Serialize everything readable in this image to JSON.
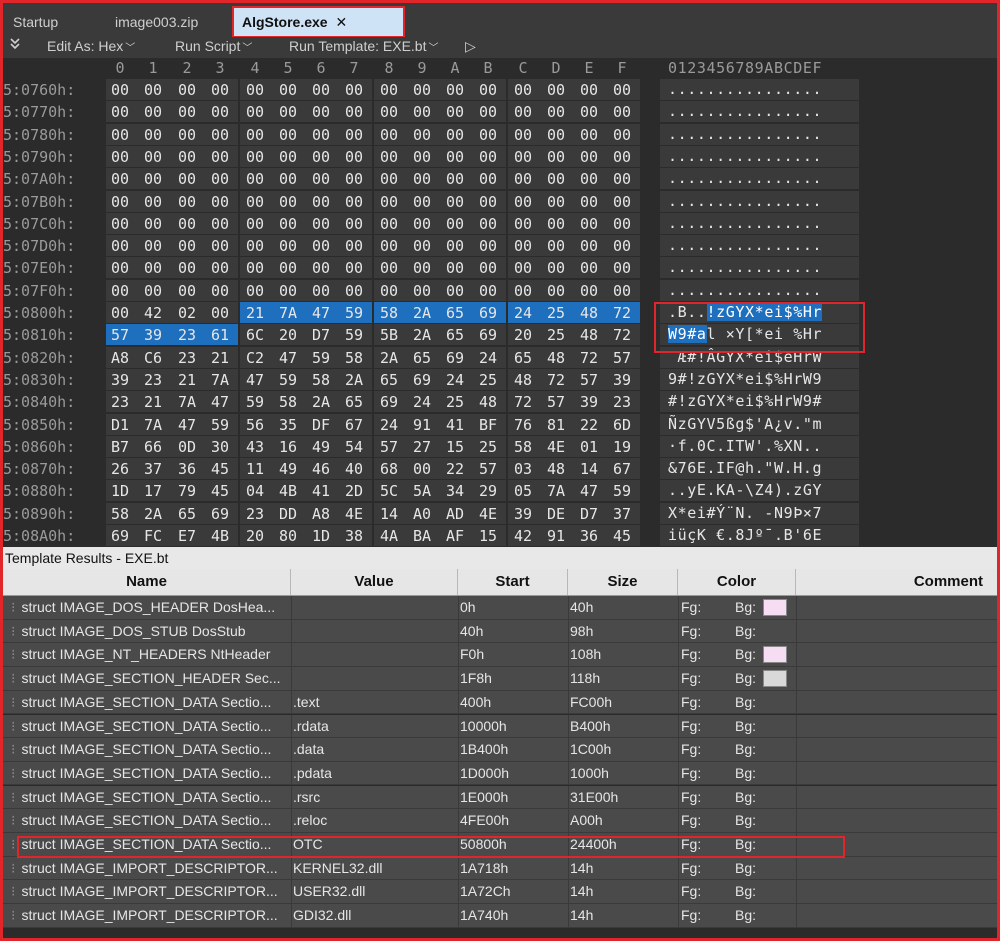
{
  "tabs": [
    {
      "label": "Startup",
      "active": false
    },
    {
      "label": "image003.zip",
      "active": false
    },
    {
      "label": "AlgStore.exe",
      "active": true,
      "close": "✕"
    }
  ],
  "toolbar": {
    "edit_as": "Edit As: Hex",
    "run_script": "Run Script",
    "run_template": "Run Template: EXE.bt",
    "play_icon": "▷"
  },
  "hex": {
    "col_headers": [
      "0",
      "1",
      "2",
      "3",
      "4",
      "5",
      "6",
      "7",
      "8",
      "9",
      "A",
      "B",
      "C",
      "D",
      "E",
      "F"
    ],
    "ascii_header": "0123456789ABCDEF",
    "rows": [
      {
        "addr": "5:0760h:",
        "bytes": [
          "00",
          "00",
          "00",
          "00",
          "00",
          "00",
          "00",
          "00",
          "00",
          "00",
          "00",
          "00",
          "00",
          "00",
          "00",
          "00"
        ],
        "ascii": "................"
      },
      {
        "addr": "5:0770h:",
        "bytes": [
          "00",
          "00",
          "00",
          "00",
          "00",
          "00",
          "00",
          "00",
          "00",
          "00",
          "00",
          "00",
          "00",
          "00",
          "00",
          "00"
        ],
        "ascii": "................"
      },
      {
        "addr": "5:0780h:",
        "bytes": [
          "00",
          "00",
          "00",
          "00",
          "00",
          "00",
          "00",
          "00",
          "00",
          "00",
          "00",
          "00",
          "00",
          "00",
          "00",
          "00"
        ],
        "ascii": "................"
      },
      {
        "addr": "5:0790h:",
        "bytes": [
          "00",
          "00",
          "00",
          "00",
          "00",
          "00",
          "00",
          "00",
          "00",
          "00",
          "00",
          "00",
          "00",
          "00",
          "00",
          "00"
        ],
        "ascii": "................"
      },
      {
        "addr": "5:07A0h:",
        "bytes": [
          "00",
          "00",
          "00",
          "00",
          "00",
          "00",
          "00",
          "00",
          "00",
          "00",
          "00",
          "00",
          "00",
          "00",
          "00",
          "00"
        ],
        "ascii": "................"
      },
      {
        "addr": "5:07B0h:",
        "bytes": [
          "00",
          "00",
          "00",
          "00",
          "00",
          "00",
          "00",
          "00",
          "00",
          "00",
          "00",
          "00",
          "00",
          "00",
          "00",
          "00"
        ],
        "ascii": "................"
      },
      {
        "addr": "5:07C0h:",
        "bytes": [
          "00",
          "00",
          "00",
          "00",
          "00",
          "00",
          "00",
          "00",
          "00",
          "00",
          "00",
          "00",
          "00",
          "00",
          "00",
          "00"
        ],
        "ascii": "................"
      },
      {
        "addr": "5:07D0h:",
        "bytes": [
          "00",
          "00",
          "00",
          "00",
          "00",
          "00",
          "00",
          "00",
          "00",
          "00",
          "00",
          "00",
          "00",
          "00",
          "00",
          "00"
        ],
        "ascii": "................"
      },
      {
        "addr": "5:07E0h:",
        "bytes": [
          "00",
          "00",
          "00",
          "00",
          "00",
          "00",
          "00",
          "00",
          "00",
          "00",
          "00",
          "00",
          "00",
          "00",
          "00",
          "00"
        ],
        "ascii": "................"
      },
      {
        "addr": "5:07F0h:",
        "bytes": [
          "00",
          "00",
          "00",
          "00",
          "00",
          "00",
          "00",
          "00",
          "00",
          "00",
          "00",
          "00",
          "00",
          "00",
          "00",
          "00"
        ],
        "ascii": "................"
      },
      {
        "addr": "5:0800h:",
        "bytes": [
          "00",
          "42",
          "02",
          "00",
          "21",
          "7A",
          "47",
          "59",
          "58",
          "2A",
          "65",
          "69",
          "24",
          "25",
          "48",
          "72"
        ],
        "ascii": ".B..!zGYX*ei$%Hr"
      },
      {
        "addr": "5:0810h:",
        "bytes": [
          "57",
          "39",
          "23",
          "61",
          "6C",
          "20",
          "D7",
          "59",
          "5B",
          "2A",
          "65",
          "69",
          "20",
          "25",
          "48",
          "72"
        ],
        "ascii": "W9#al ×Y[*ei %Hr"
      },
      {
        "addr": "5:0820h:",
        "bytes": [
          "A8",
          "C6",
          "23",
          "21",
          "C2",
          "47",
          "59",
          "58",
          "2A",
          "65",
          "69",
          "24",
          "65",
          "48",
          "72",
          "57"
        ],
        "ascii": " Æ#!ÂGYX*ei$eHrW"
      },
      {
        "addr": "5:0830h:",
        "bytes": [
          "39",
          "23",
          "21",
          "7A",
          "47",
          "59",
          "58",
          "2A",
          "65",
          "69",
          "24",
          "25",
          "48",
          "72",
          "57",
          "39"
        ],
        "ascii": "9#!zGYX*ei$%HrW9"
      },
      {
        "addr": "5:0840h:",
        "bytes": [
          "23",
          "21",
          "7A",
          "47",
          "59",
          "58",
          "2A",
          "65",
          "69",
          "24",
          "25",
          "48",
          "72",
          "57",
          "39",
          "23"
        ],
        "ascii": "#!zGYX*ei$%HrW9#"
      },
      {
        "addr": "5:0850h:",
        "bytes": [
          "D1",
          "7A",
          "47",
          "59",
          "56",
          "35",
          "DF",
          "67",
          "24",
          "91",
          "41",
          "BF",
          "76",
          "81",
          "22",
          "6D"
        ],
        "ascii": "ÑzGYV5ßg$'A¿v.\"m"
      },
      {
        "addr": "5:0860h:",
        "bytes": [
          "B7",
          "66",
          "0D",
          "30",
          "43",
          "16",
          "49",
          "54",
          "57",
          "27",
          "15",
          "25",
          "58",
          "4E",
          "01",
          "19"
        ],
        "ascii": "·f.0C.ITW'.%XN.."
      },
      {
        "addr": "5:0870h:",
        "bytes": [
          "26",
          "37",
          "36",
          "45",
          "11",
          "49",
          "46",
          "40",
          "68",
          "00",
          "22",
          "57",
          "03",
          "48",
          "14",
          "67"
        ],
        "ascii": "&76E.IF@h.\"W.H.g"
      },
      {
        "addr": "5:0880h:",
        "bytes": [
          "1D",
          "17",
          "79",
          "45",
          "04",
          "4B",
          "41",
          "2D",
          "5C",
          "5A",
          "34",
          "29",
          "05",
          "7A",
          "47",
          "59"
        ],
        "ascii": "..yE.KA-\\Z4).zGY"
      },
      {
        "addr": "5:0890h:",
        "bytes": [
          "58",
          "2A",
          "65",
          "69",
          "23",
          "DD",
          "A8",
          "4E",
          "14",
          "A0",
          "AD",
          "4E",
          "39",
          "DE",
          "D7",
          "37"
        ],
        "ascii": "X*ei#Ý¨N. -N9Þ×7"
      },
      {
        "addr": "5:08A0h:",
        "bytes": [
          "69",
          "FC",
          "E7",
          "4B",
          "20",
          "80",
          "1D",
          "38",
          "4A",
          "BA",
          "AF",
          "15",
          "42",
          "91",
          "36",
          "45"
        ],
        "ascii": "iüçK €.8Jº¯.B'6E"
      }
    ]
  },
  "template": {
    "title": "Template Results - EXE.bt",
    "headers": {
      "name": "Name",
      "value": "Value",
      "start": "Start",
      "size": "Size",
      "color": "Color",
      "comment": "Comment"
    },
    "fg_label": "Fg:",
    "bg_label": "Bg:",
    "rows": [
      {
        "name": "struct IMAGE_DOS_HEADER DosHea...",
        "value": "",
        "start": "0h",
        "size": "40h",
        "swatch": "#f6ddf4"
      },
      {
        "name": "struct IMAGE_DOS_STUB DosStub",
        "value": "",
        "start": "40h",
        "size": "98h",
        "swatch": ""
      },
      {
        "name": "struct IMAGE_NT_HEADERS NtHeader",
        "value": "",
        "start": "F0h",
        "size": "108h",
        "swatch": "#f6ddf4"
      },
      {
        "name": "struct IMAGE_SECTION_HEADER Sec...",
        "value": "",
        "start": "1F8h",
        "size": "118h",
        "swatch": "#d9d9d9"
      },
      {
        "name": "struct IMAGE_SECTION_DATA Sectio...",
        "value": ".text",
        "start": "400h",
        "size": "FC00h",
        "swatch": ""
      },
      {
        "name": "struct IMAGE_SECTION_DATA Sectio...",
        "value": ".rdata",
        "start": "10000h",
        "size": "B400h",
        "swatch": ""
      },
      {
        "name": "struct IMAGE_SECTION_DATA Sectio...",
        "value": ".data",
        "start": "1B400h",
        "size": "1C00h",
        "swatch": ""
      },
      {
        "name": "struct IMAGE_SECTION_DATA Sectio...",
        "value": ".pdata",
        "start": "1D000h",
        "size": "1000h",
        "swatch": ""
      },
      {
        "name": "struct IMAGE_SECTION_DATA Sectio...",
        "value": ".rsrc",
        "start": "1E000h",
        "size": "31E00h",
        "swatch": ""
      },
      {
        "name": "struct IMAGE_SECTION_DATA Sectio...",
        "value": ".reloc",
        "start": "4FE00h",
        "size": "A00h",
        "swatch": ""
      },
      {
        "name": "struct IMAGE_SECTION_DATA Sectio...",
        "value": "OTC",
        "start": "50800h",
        "size": "24400h",
        "swatch": ""
      },
      {
        "name": "struct IMAGE_IMPORT_DESCRIPTOR...",
        "value": "KERNEL32.dll",
        "start": "1A718h",
        "size": "14h",
        "swatch": ""
      },
      {
        "name": "struct IMAGE_IMPORT_DESCRIPTOR...",
        "value": "USER32.dll",
        "start": "1A72Ch",
        "size": "14h",
        "swatch": ""
      },
      {
        "name": "struct IMAGE_IMPORT_DESCRIPTOR...",
        "value": "GDI32.dll",
        "start": "1A740h",
        "size": "14h",
        "swatch": ""
      }
    ]
  },
  "colors": {
    "accent_red": "#e0262b",
    "selection": "#1f6fbf",
    "active_tab": "#cfe3f6"
  }
}
